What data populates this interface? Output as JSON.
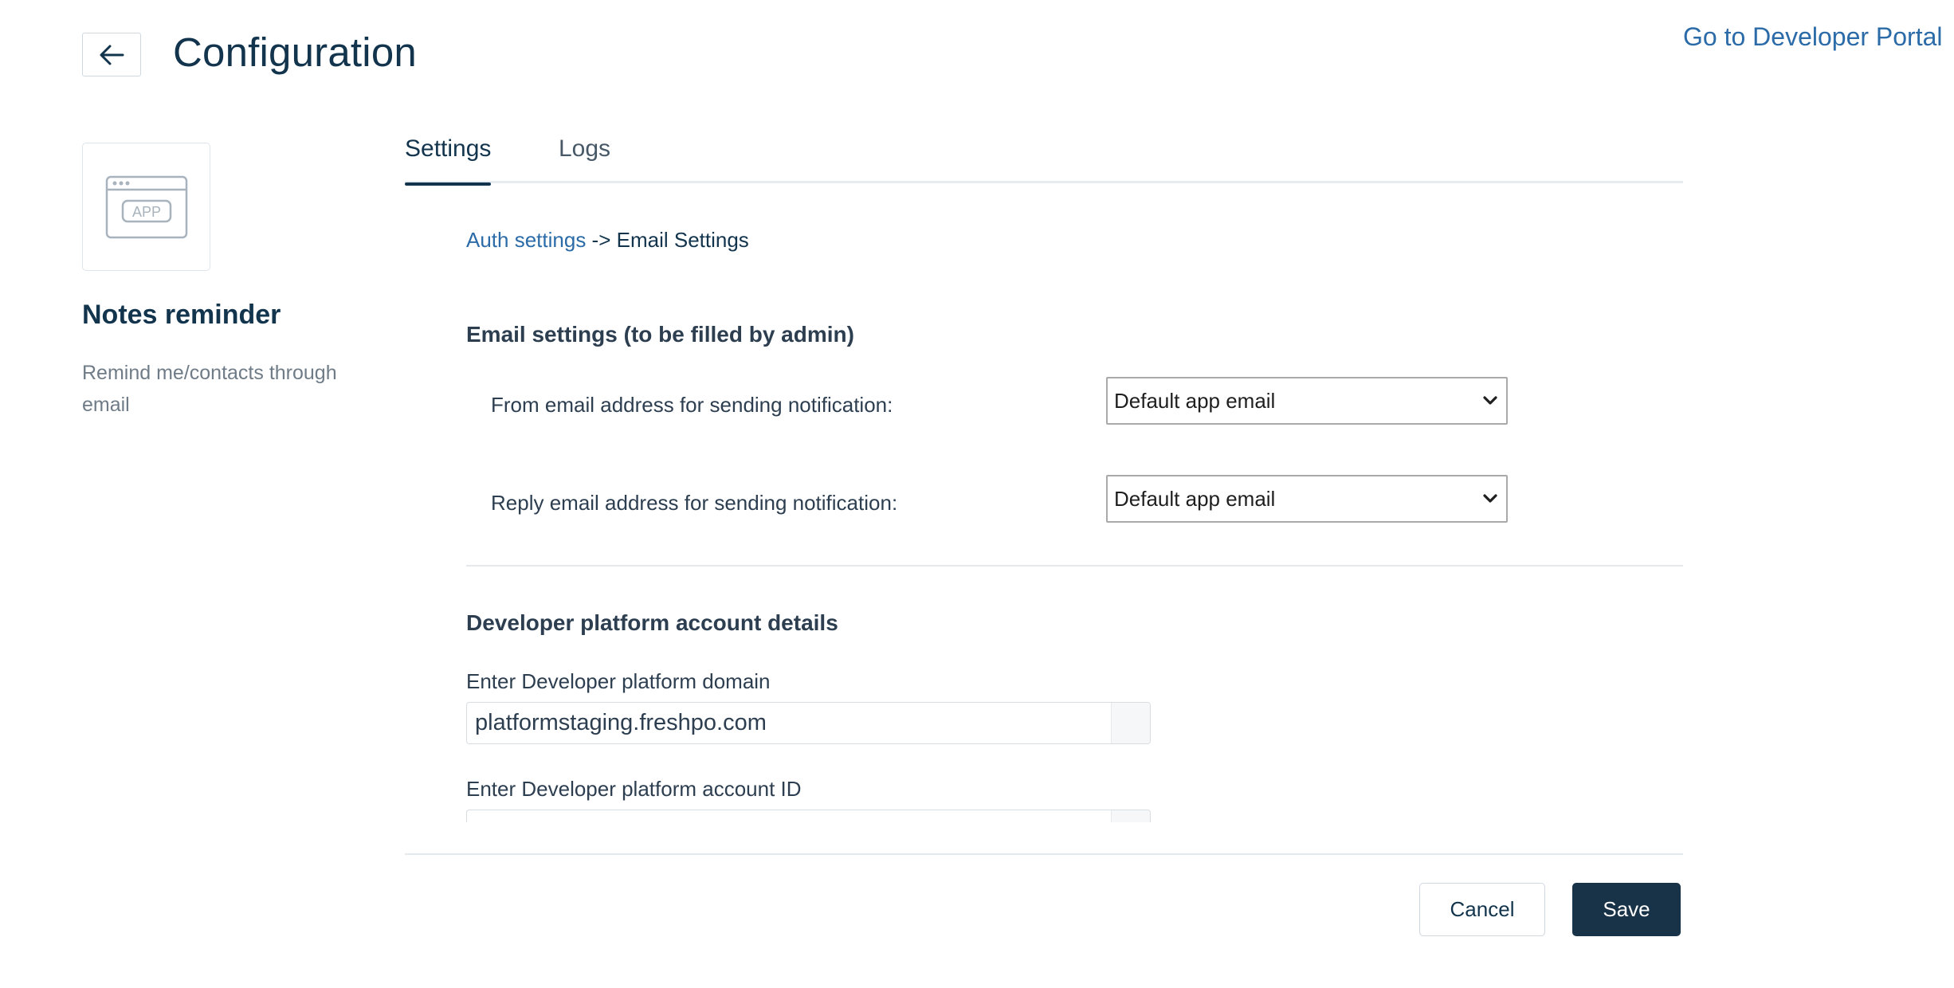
{
  "header": {
    "title": "Configuration",
    "portal_link": "Go to Developer Portal"
  },
  "app": {
    "icon_label": "APP",
    "name": "Notes reminder",
    "description": "Remind me/contacts through email"
  },
  "tabs": [
    {
      "label": "Settings",
      "active": true
    },
    {
      "label": "Logs",
      "active": false
    }
  ],
  "breadcrumb": {
    "link": "Auth settings",
    "separator": " -> ",
    "current": "Email Settings"
  },
  "email_settings": {
    "title": "Email settings (to be filled by admin)",
    "from_label": "From email address for sending notification:",
    "from_value": "Default app email",
    "reply_label": "Reply email address for sending notification:",
    "reply_value": "Default app email"
  },
  "developer_platform": {
    "title": "Developer platform account details",
    "domain_label": "Enter Developer platform domain",
    "domain_value": "platformstaging.freshpo.com",
    "account_id_label": "Enter Developer platform account ID"
  },
  "footer": {
    "cancel_label": "Cancel",
    "save_label": "Save"
  },
  "colors": {
    "primary_dark": "#183247",
    "link": "#2b6ba8",
    "title": "#12344d"
  }
}
